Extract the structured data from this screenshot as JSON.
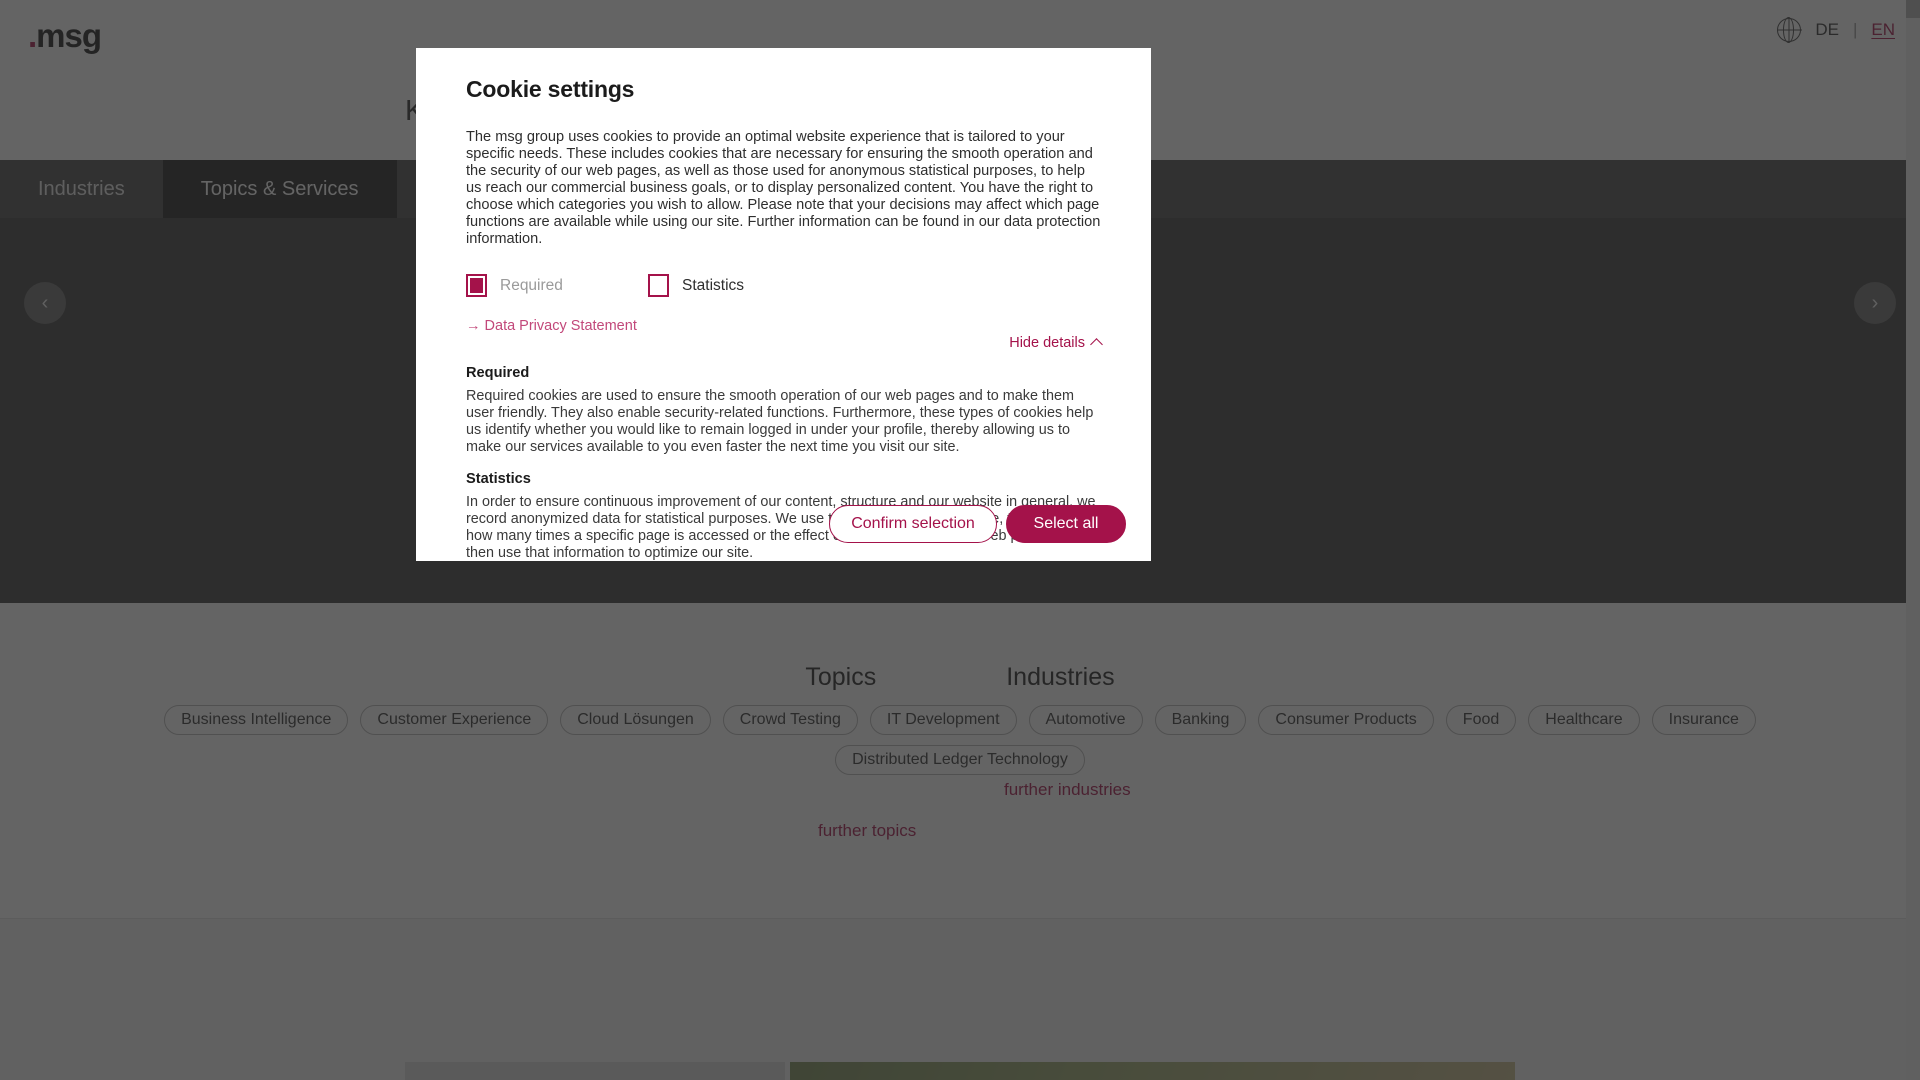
{
  "site": {
    "logo_text": "msg",
    "logo_dot": ".",
    "language": {
      "globe_icon": "globe-icon",
      "de_label": "DE",
      "separator": "|",
      "en_label": "EN"
    },
    "nav": [
      {
        "label": "Industries",
        "active": false
      },
      {
        "label": "Topics & Services",
        "active": true
      }
    ],
    "carousel": {
      "prev_icon": "chevron-left-icon",
      "next_icon": "chevron-right-icon"
    },
    "section_headings": [
      "Topics",
      "Industries"
    ],
    "topic_tags": [
      "Business Intelligence",
      "Customer Experience",
      "Cloud Lösungen",
      "Crowd Testing",
      "IT Development",
      "Distributed Ledger Technology"
    ],
    "industry_tags": [
      "Automotive",
      "Banking",
      "Consumer Products",
      "Food",
      "Healthcare",
      "Insurance"
    ],
    "further_industries": "further industries",
    "further_topics": "further topics",
    "key_topics_title": "Key Topics"
  },
  "dialog": {
    "title": "Cookie settings",
    "intro": "The msg group uses cookies to provide an optimal website experience that is tailored to your specific needs. These includes cookies that are necessary for ensuring the smooth operation and the security of our web pages, as well as those used for anonymous statistical purposes, to help us reach our commercial business goals, or to display personalized content. You have the right to choose which categories you wish to allow. Please note that your decisions may affect which page functions are available while using our site. Further information can be found in our data protection information.",
    "checkboxes": [
      {
        "label": "Required",
        "checked": true,
        "disabled": true
      },
      {
        "label": "Statistics",
        "checked": false,
        "disabled": false
      }
    ],
    "privacy_link": "→ Data Privacy Statement",
    "toggle_details_label": "Hide details",
    "toggle_icon": "chevron-up-icon",
    "details": [
      {
        "heading": "Required",
        "body": "Required cookies are used to ensure the smooth operation of our web pages and to make them user friendly. They also enable security-related functions. Furthermore, these types of cookies help us identify whether you would like to remain logged in under your profile, thereby allowing us to make our services available to you even faster the next time you visit our site."
      },
      {
        "heading": "Statistics",
        "body": "In order to ensure continuous improvement of our content, structure and our website in general, we record anonymized data for statistical purposes. We use these cookies, for example, to determine how many times a specific page is accessed or the effect of certain pages of our web presence; we then use that information to optimize our site."
      }
    ],
    "buttons": {
      "confirm_selection": "Confirm selection",
      "select_all": "Select all"
    },
    "accent_color": "#a4124a"
  }
}
